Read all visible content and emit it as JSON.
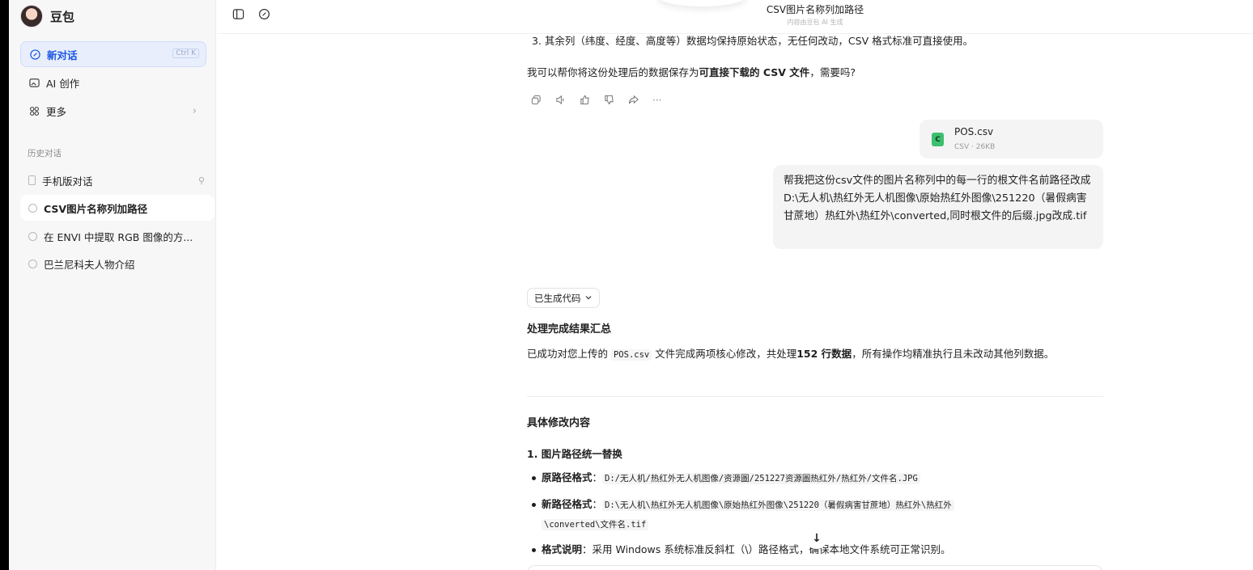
{
  "app": {
    "name": "豆包",
    "title": "CSV图片名称列加路径",
    "subtitle": "内容由豆包 AI 生成"
  },
  "sidebar": {
    "new_chat": {
      "label": "新对话",
      "shortcut": "Ctrl K"
    },
    "ai_create": {
      "label": "AI 创作"
    },
    "more": {
      "label": "更多"
    },
    "history_title": "历史对话",
    "history": [
      {
        "label": "手机版对话"
      },
      {
        "label": "CSV图片名称列加路径"
      },
      {
        "label": "在 ENVI 中提取 RGB 图像的方..."
      },
      {
        "label": "巴兰尼科夫人物介绍"
      }
    ]
  },
  "chat": {
    "prev_item": "3. 其余列（纬度、经度、高度等）数据均保持原始状态，无任何改动，CSV 格式标准可直接使用。",
    "offer_pre": "我可以帮你将这份处理后的数据保存为",
    "offer_bold": "可直接下载的 CSV 文件",
    "offer_post": "，需要吗?",
    "more_actions": "···",
    "file": {
      "name": "POS.csv",
      "meta": "CSV · 26KB",
      "badge": "C"
    },
    "user_message": "帮我把这份csv文件的图片名称列中的每一行的根文件名前路径改成D:\\无人机\\热红外无人机图像\\原始热红外图像\\251220（暑假病害甘蔗地）热红外\\热红外\\converted,同时根文件的后缀.jpg改成.tif",
    "code_chip": "已生成代码",
    "summary_title": "处理完成结果汇总",
    "summary_pre": "已成功对您上传的 ",
    "summary_code": "POS.csv",
    "summary_mid": " 文件完成两项核心修改，共处理",
    "summary_bold": "152 行数据",
    "summary_post": "，所有操作均精准执行且未改动其他列数据。",
    "details_title": "具体修改内容",
    "sub1_title": "1. 图片路径统一替换",
    "b1_label": "原路径格式",
    "b1_code": "D:/无人机/热红外无人机图像/资源圖/251227资源圖热红外/热红外/文件名.JPG",
    "b2_label": "新路径格式",
    "b2_code_line1": "D:\\无人机\\热红外无人机图像\\原始热红外图像\\251220（暑假病害甘蔗地）热红外\\热红外",
    "b2_code_line2": "\\converted\\文件名.tif",
    "b3_label": "格式说明",
    "b3_text": "：采用 Windows 系统标准反斜杠（\\）路径格式，确保本地文件系统可正常识别。",
    "colon": "：",
    "scroll_icon": "↓"
  }
}
